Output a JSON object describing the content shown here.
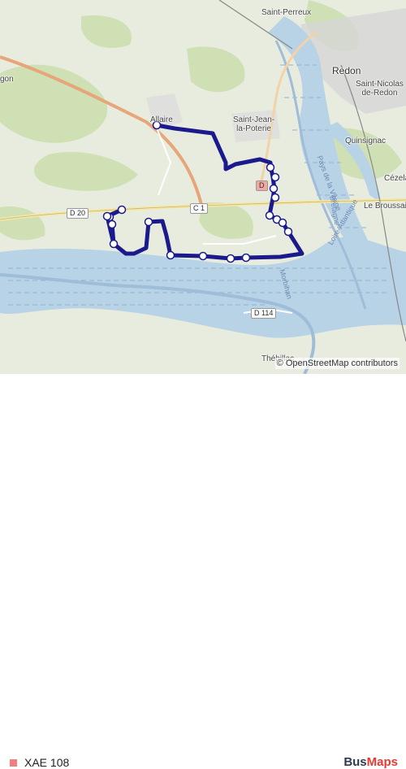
{
  "map": {
    "route_color": "#1a1a8c",
    "water_color": "#b3cde0",
    "land_color": "#e9ede2",
    "forest_color": "#c9ddb0",
    "stop_count": 20
  },
  "places": {
    "saint_perreux": "Saint-Perreux",
    "redon": "Redon",
    "gon": "gon",
    "saint_nicolas": "Saint-Nicolas\nde-Redon",
    "allaire": "Allaire",
    "saint_jean": "Saint-Jean-\nla-Poterie",
    "quinsignac": "Quinsignac",
    "cezela": "Cézela",
    "le_broussais": "Le Broussai",
    "thehillac": "Théhillac"
  },
  "roads": {
    "d20": "D 20",
    "c1": "C 1",
    "d114": "D 114",
    "d_near_poterie": "D"
  },
  "rivers": {
    "pays_de_la_vilaine": "Pays de la Vilaine",
    "bretagne": "Bretagne",
    "loire_atlantique": "Loire-Atlantique",
    "morbihan": "Morbihan"
  },
  "attribution": "© OpenStreetMap contributors",
  "legend": {
    "swatch_color": "#f08080",
    "route_name": "XAE 108"
  },
  "brand": {
    "part1": "Bus",
    "part2": "Maps"
  }
}
